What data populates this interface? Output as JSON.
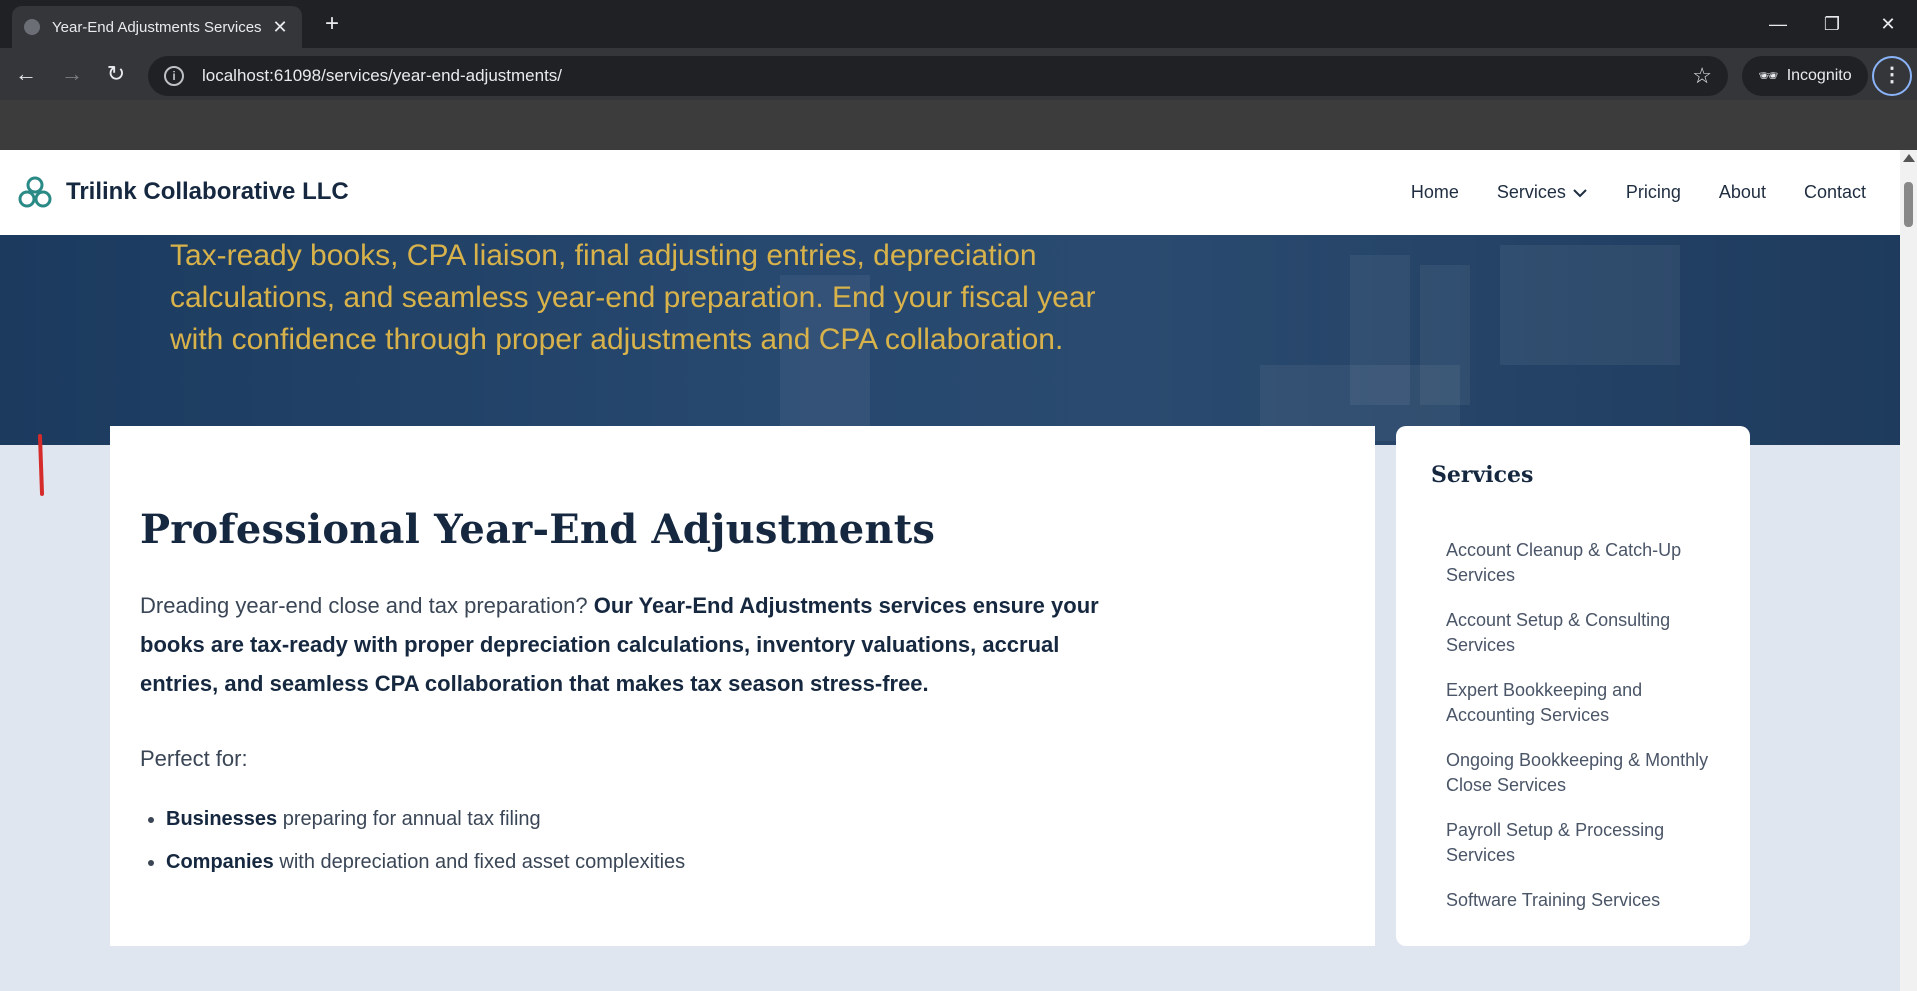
{
  "browser": {
    "tab_title": "Year-End Adjustments Services",
    "tab_close": "✕",
    "new_tab": "+",
    "url": "localhost:61098/services/year-end-adjustments/",
    "incognito_label": "Incognito",
    "window_controls": [
      "—",
      "❐",
      "✕"
    ]
  },
  "site": {
    "brand": "Trilink Collaborative LLC",
    "nav": [
      {
        "label": "Home"
      },
      {
        "label": "Services"
      },
      {
        "label": "Pricing"
      },
      {
        "label": "About"
      },
      {
        "label": "Contact"
      }
    ],
    "accent_color": "#d8b24a",
    "brand_color": "#16283f"
  },
  "hero": {
    "subtitle": "Tax-ready books, CPA liaison, final adjusting entries, depreciation calculations, and seamless year-end preparation. End your fiscal year with confidence through proper adjustments and CPA collaboration."
  },
  "main": {
    "heading": "Professional Year-End Adjustments",
    "intro_lead": "Dreading year-end close and tax preparation? ",
    "intro_bold": "Our Year-End Adjustments services ensure your books are tax-ready with proper depreciation calculations, inventory valuations, accrual entries, and seamless CPA collaboration that makes tax season stress-free.",
    "perfect_for": "Perfect for:",
    "audience": [
      {
        "bold": "Businesses",
        "text": " preparing for annual tax filing"
      },
      {
        "bold": "Companies",
        "text": " with depreciation and fixed asset complexities"
      }
    ]
  },
  "sidebar": {
    "title": "Services",
    "items": [
      {
        "label": "Account Cleanup & Catch-Up Services"
      },
      {
        "label": "Account Setup & Consulting Services"
      },
      {
        "label": "Expert Bookkeeping and Accounting Services"
      },
      {
        "label": "Ongoing Bookkeeping & Monthly Close Services"
      },
      {
        "label": "Payroll Setup & Processing Services"
      },
      {
        "label": "Software Training Services"
      }
    ]
  }
}
